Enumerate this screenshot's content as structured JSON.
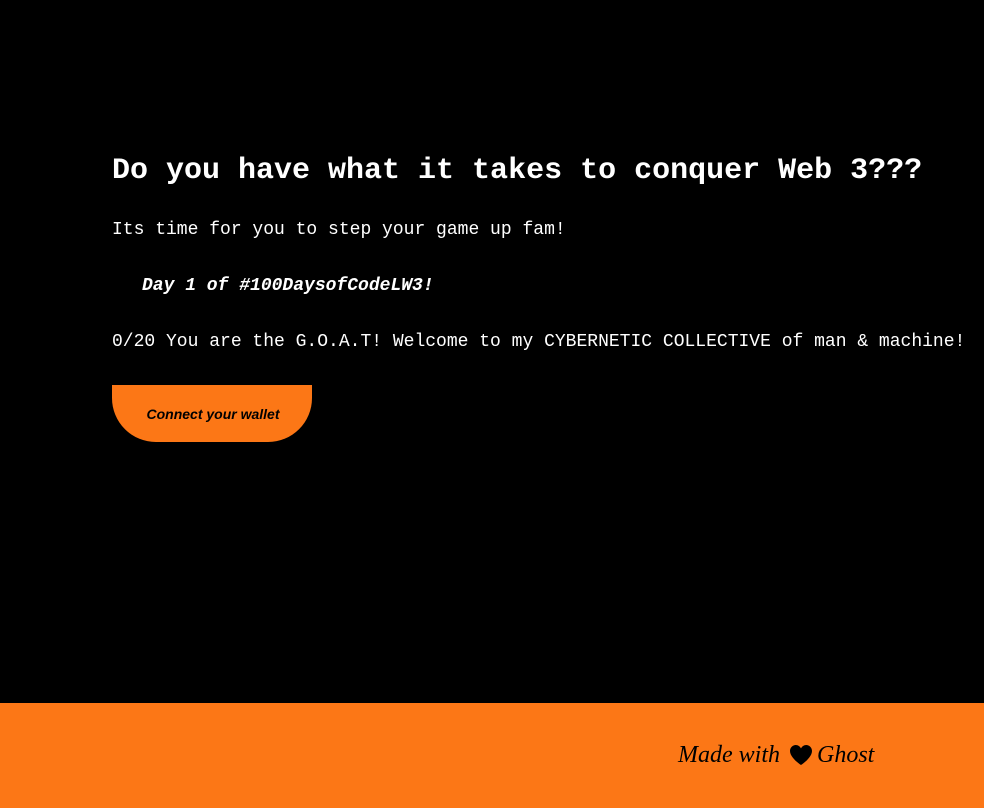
{
  "hero": {
    "headline": "Do you have what it takes to conquer Web 3???",
    "tagline": "Its time for you to step your game up fam!",
    "day_label": "Day 1 of #100DaysofCodeLW3!",
    "progress_text": "0/20 You are the G.O.A.T! Welcome to my CYBERNETIC COLLECTIVE of man & machine!",
    "connect_button_label": "Connect your wallet"
  },
  "footer": {
    "made_with_prefix": "Made with",
    "heart_icon": "heart-icon",
    "made_with_suffix": "Ghost"
  },
  "colors": {
    "background": "#000000",
    "text": "#ffffff",
    "accent": "#fc7716"
  }
}
